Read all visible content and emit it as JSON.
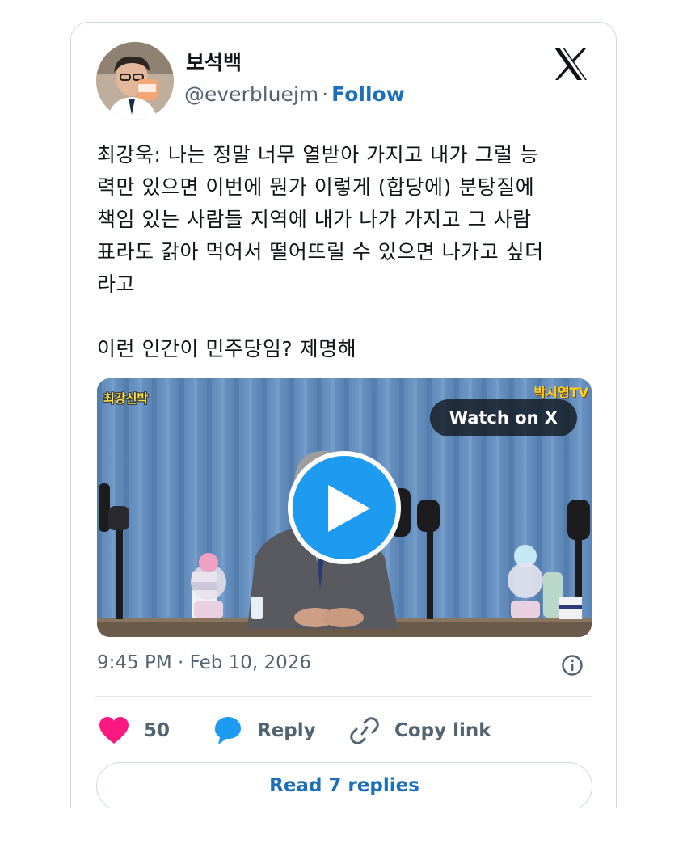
{
  "author": {
    "display_name": "보석백",
    "handle": "@everbluejm",
    "separator": "·",
    "follow_label": "Follow"
  },
  "tweet": {
    "text": "최강욱: 나는 정말 너무 열받아 가지고 내가 그럴 능\n력만 있으면 이번에 뭔가 이렇게 (합당에) 분탕질에\n책임 있는 사람들 지역에 내가 나가 가지고 그 사람\n표라도 갉아 먹어서 떨어뜨릴 수 있으면 나가고 싶더\n라고\n\n이런 인간이 민주당임? 제명해"
  },
  "media": {
    "channel_badge": "최강신박",
    "corner_logo": "박시영TV",
    "watch_label": "Watch on X",
    "play_icon": "play-icon"
  },
  "meta": {
    "timestamp": "9:45 PM · Feb 10, 2026"
  },
  "actions": {
    "like_count": "50",
    "reply_label": "Reply",
    "copy_label": "Copy link",
    "read_replies_label": "Read 7 replies"
  },
  "colors": {
    "like": "#f91880",
    "reply": "#1d9bf0",
    "link": "#1d6fb8",
    "secondary_text": "#536471"
  }
}
